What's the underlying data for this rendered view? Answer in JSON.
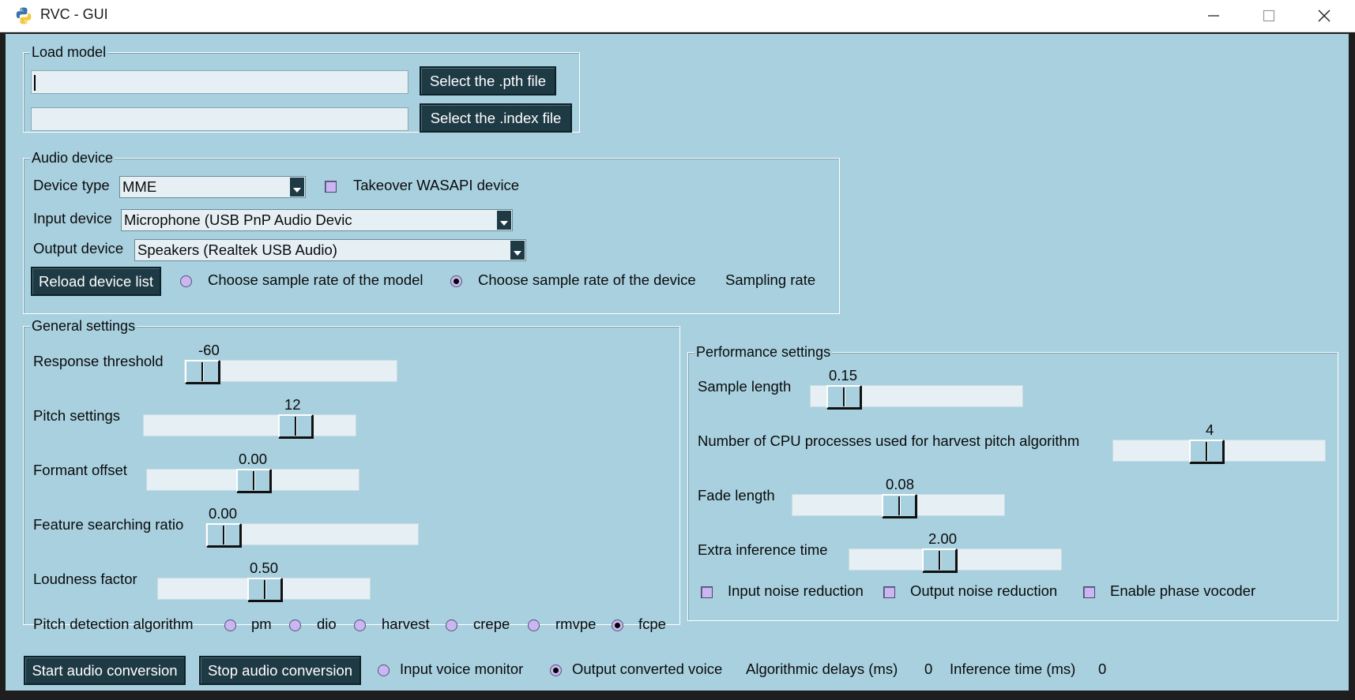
{
  "window": {
    "title": "RVC - GUI"
  },
  "load_model": {
    "legend": "Load model",
    "pth_path": "",
    "index_path": "",
    "pth_button": "Select the .pth file",
    "index_button": "Select the .index file"
  },
  "audio_device": {
    "legend": "Audio device",
    "device_type_label": "Device type",
    "device_type_value": "MME",
    "takeover_label": "Takeover WASAPI device",
    "takeover_checked": false,
    "input_label": "Input device",
    "input_value": "Microphone (USB PnP Audio Devic",
    "output_label": "Output device",
    "output_value": "Speakers (Realtek USB Audio)",
    "reload_button": "Reload device list",
    "sr_model_label": "Choose sample rate of the model",
    "sr_device_label": "Choose sample rate of the device",
    "sr_selected": "device",
    "sampling_rate_label": "Sampling rate"
  },
  "general": {
    "legend": "General settings",
    "response_threshold": {
      "label": "Response threshold",
      "value": "-60"
    },
    "pitch": {
      "label": "Pitch settings",
      "value": "12"
    },
    "formant": {
      "label": "Formant offset",
      "value": "0.00"
    },
    "feature_ratio": {
      "label": "Feature searching ratio",
      "value": "0.00"
    },
    "loudness": {
      "label": "Loudness factor",
      "value": "0.50"
    },
    "pitch_algo_label": "Pitch detection algorithm",
    "pitch_algos": [
      "pm",
      "dio",
      "harvest",
      "crepe",
      "rmvpe",
      "fcpe"
    ],
    "pitch_algo_selected": "fcpe"
  },
  "performance": {
    "legend": "Performance settings",
    "sample_length": {
      "label": "Sample length",
      "value": "0.15"
    },
    "cpu_processes": {
      "label": "Number of CPU processes used for harvest pitch algorithm",
      "value": "4"
    },
    "fade_length": {
      "label": "Fade length",
      "value": "0.08"
    },
    "extra_time": {
      "label": "Extra inference time",
      "value": "2.00"
    },
    "input_noise_label": "Input noise reduction",
    "output_noise_label": "Output noise reduction",
    "phase_vocoder_label": "Enable phase vocoder"
  },
  "bottom": {
    "start_button": "Start audio conversion",
    "stop_button": "Stop audio conversion",
    "input_monitor_label": "Input voice monitor",
    "output_converted_label": "Output converted voice",
    "monitor_selected": "output",
    "delay_label": "Algorithmic delays (ms)",
    "delay_value": "0",
    "inference_label": "Inference time (ms)",
    "inference_value": "0"
  },
  "colors": {
    "background": "#a8d0df",
    "button": "#1e3a45",
    "entry": "#e5eff4",
    "check": "#cbb6f4"
  }
}
